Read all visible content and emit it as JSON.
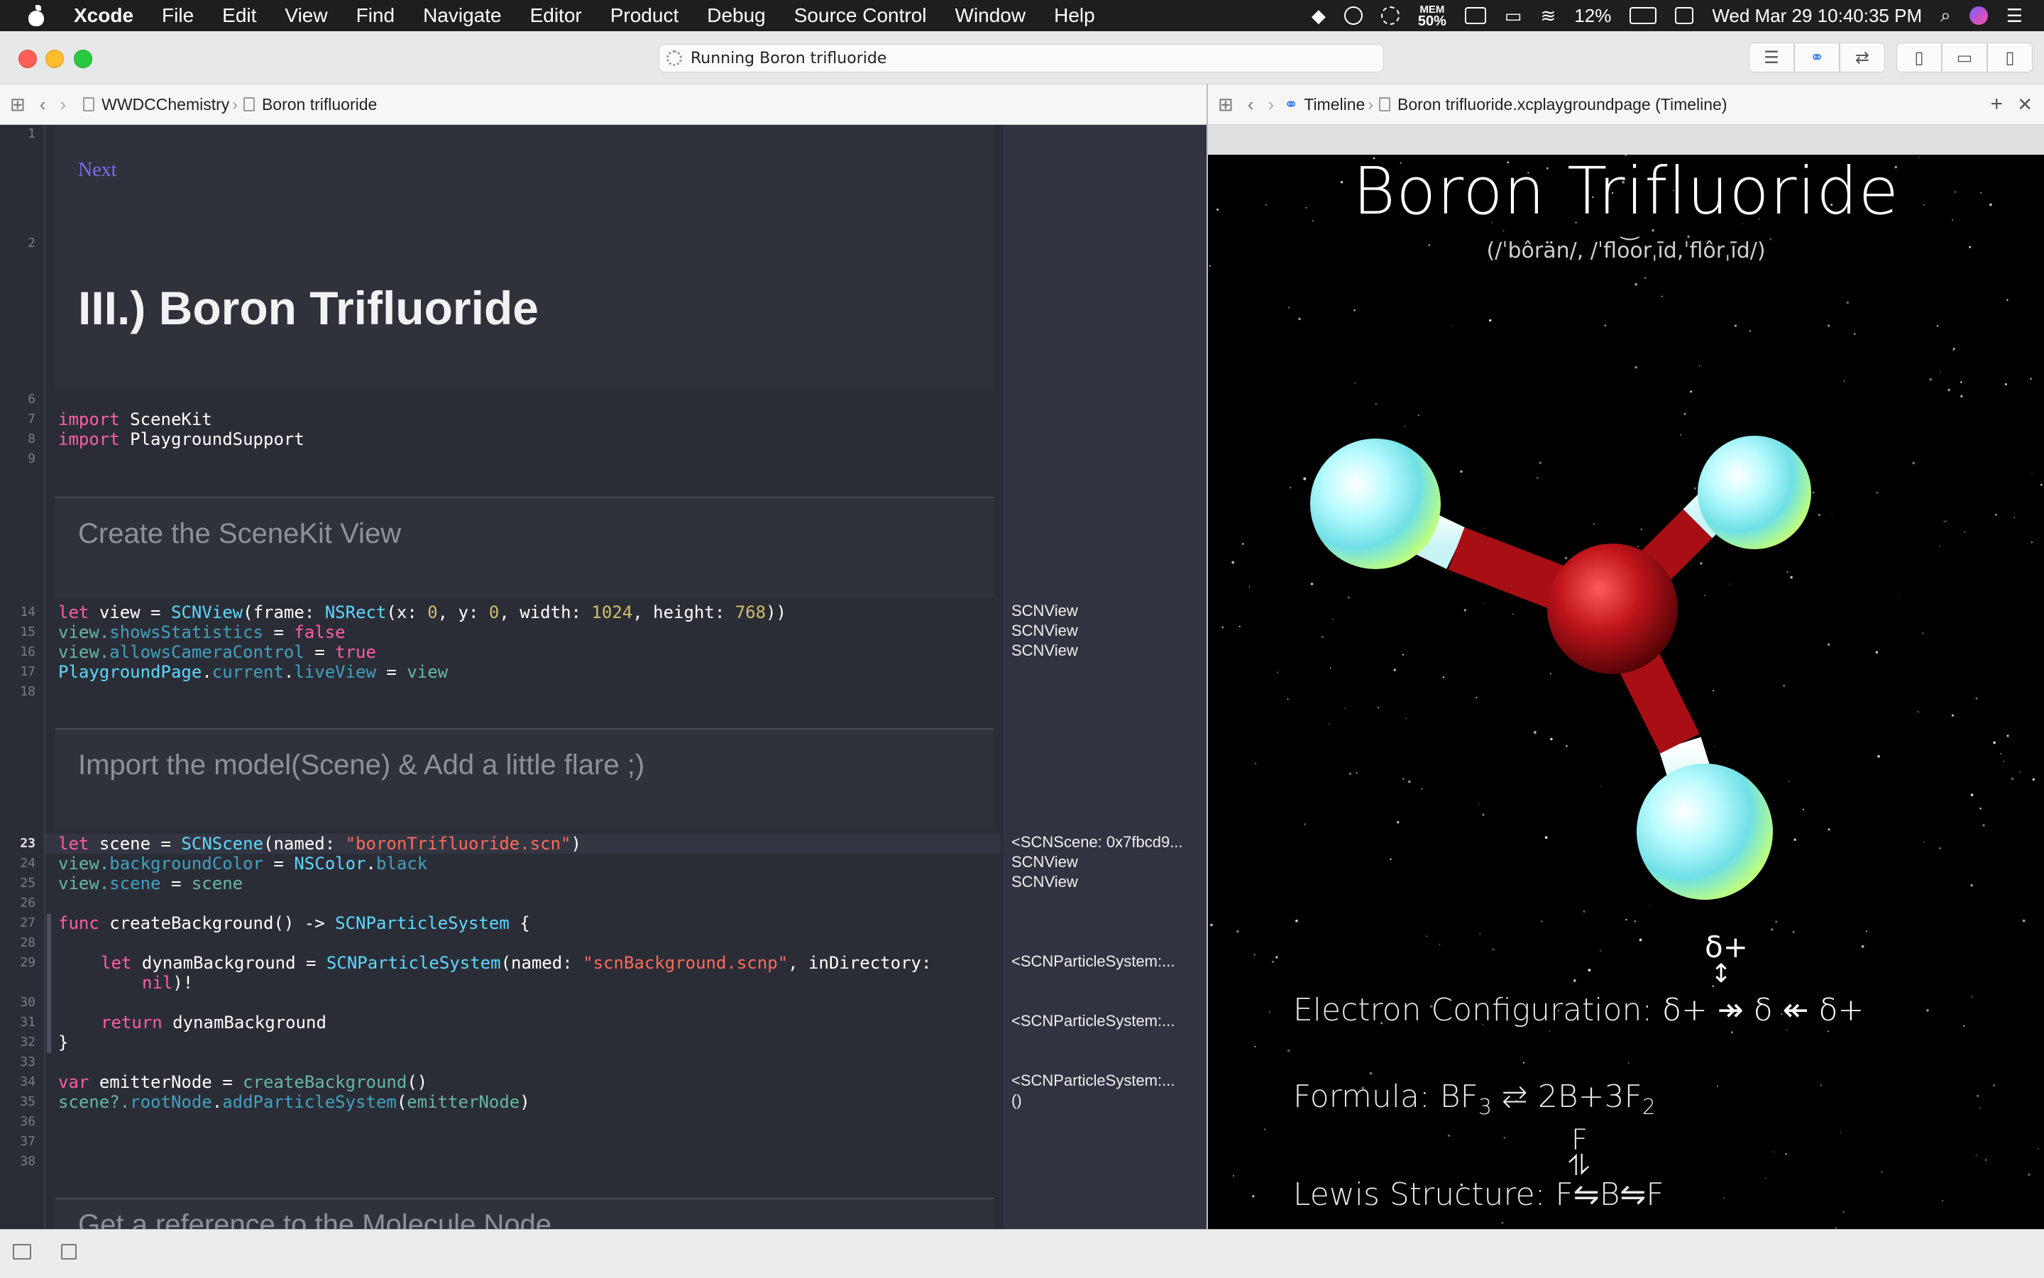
{
  "menubar": {
    "app_name": "Xcode",
    "items": [
      "File",
      "Edit",
      "View",
      "Find",
      "Navigate",
      "Editor",
      "Product",
      "Debug",
      "Source Control",
      "Window",
      "Help"
    ],
    "mem_label": "MEM",
    "mem_value": "50%",
    "battery": "12%",
    "clock": "Wed Mar 29  10:40:35 PM"
  },
  "toolbar": {
    "activity_text": "Running Boron trifluoride"
  },
  "left_jumpbar": {
    "project": "WWDCChemistry",
    "page": "Boron trifluoride"
  },
  "right_jumpbar": {
    "mode": "Timeline",
    "file": "Boron trifluoride.xcplaygroundpage (Timeline)"
  },
  "editor": {
    "next_link": "Next",
    "heading": "III.) Boron Trifluoride",
    "section1": "Create the SceneKit View",
    "section2": "Import the model(Scene) & Add a little flare ;)",
    "section3_partial": "Get a reference to the Molecule Node",
    "line_numbers": {
      "l1": "1",
      "l2": "2",
      "l6": "6",
      "l7": "7",
      "l8": "8",
      "l9": "9",
      "l14": "14",
      "l15": "15",
      "l16": "16",
      "l17": "17",
      "l18": "18",
      "l23": "23",
      "l24": "24",
      "l25": "25",
      "l26": "26",
      "l27": "27",
      "l28": "28",
      "l29": "29",
      "l30": "30",
      "l31": "31",
      "l32": "32",
      "l33": "33",
      "l34": "34",
      "l35": "35",
      "l36": "36",
      "l37": "37",
      "l38": "38"
    },
    "code": {
      "import_kw": "import",
      "import1": "SceneKit",
      "import2": "PlaygroundSupport",
      "let": "let",
      "var": "var",
      "func": "func",
      "return": "return",
      "view": "view",
      "SCNView": "SCNView",
      "frame": "(frame: ",
      "NSRect": "NSRect",
      "x": "(x: ",
      "zero": "0",
      "y": ", y: ",
      "width": ", width: ",
      "w1024": "1024",
      "height": ", height: ",
      "h768": "768",
      "close2": "))",
      "view_dot": "view.",
      "showsStatistics": "showsStatistics",
      "allowsCameraControl": "allowsCameraControl",
      "eq": " = ",
      "false": "false",
      "true": "true",
      "PlaygroundPage": "PlaygroundPage",
      "current": "current",
      "liveView": "liveView",
      "dot": ".",
      "scene": "scene",
      "SCNScene": "SCNScene",
      "named": "(named: ",
      "scn_name": "\"boronTrifluoride.scn\"",
      "close1": ")",
      "backgroundColor": "backgroundColor",
      "NSColor": "NSColor",
      "black": "black",
      "createBackground": "createBackground",
      "arrow": "() -> ",
      "SCNParticleSystem": "SCNParticleSystem",
      "brace_open": " {",
      "brace_close": "}",
      "dynamBackground": "dynamBackground",
      "scnp_name": "\"scnBackground.scnp\"",
      "inDirectory": ", inDirectory:",
      "nil_kw": "nil",
      "bang": ")!",
      "emitterNode": "emitterNode",
      "call_empty": "()",
      "scene_opt": "scene?.",
      "rootNode": "rootNode",
      "addParticleSystem": "addParticleSystem",
      "open_paren": "("
    }
  },
  "results": {
    "r14": "SCNView",
    "r15": "SCNView",
    "r16": "SCNView",
    "r23": "<SCNScene: 0x7fbcd9...",
    "r24": "SCNView",
    "r25": "SCNView",
    "r29": "<SCNParticleSystem:...",
    "r31": "<SCNParticleSystem:...",
    "r34": "<SCNParticleSystem:...",
    "r35": "()"
  },
  "liveview": {
    "title": "Boron Trifluoride",
    "pronunciation": "(/ˈbôrän/, /ˈflo͝orˌīd,ˈflôrˌīd/)",
    "charge_top": "δ+",
    "charge_arrow": "↕",
    "electron_label": "Electron Configuration: ",
    "electron_value": "δ+ ↠ δ ↞ δ+",
    "formula_label": "Formula: BF",
    "formula_sub": "3",
    "formula_eq": " ⇄ 2B+3F",
    "formula_sub2": "2",
    "lewis_top": "F",
    "lewis_arrows": "⥮",
    "lewis_label": "Lewis Structure: F",
    "lewis_rest": "⇋B⇋F",
    "colors": {
      "atom_fluorine": "#7fe8ea",
      "atom_boron": "#b3141b",
      "background": "#000000"
    }
  }
}
